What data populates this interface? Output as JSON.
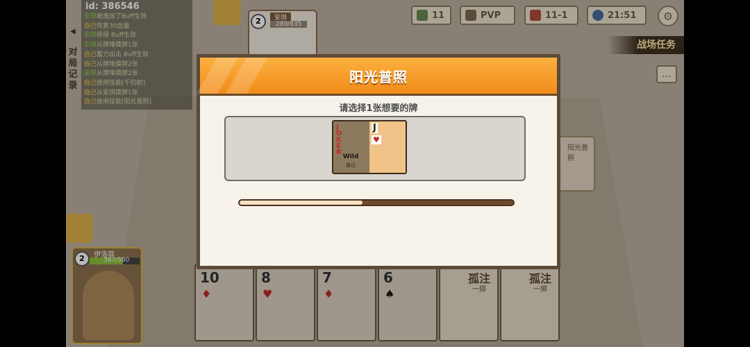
{
  "player_id": "id: 386546",
  "log_title": "对局记录",
  "log_lines": [
    {
      "who": "安琪",
      "text": "被施加了Buff生效"
    },
    {
      "who": "自己",
      "text": "恢复30血量"
    },
    {
      "who": "安琪",
      "text": "获得 Buff生效"
    },
    {
      "who": "安琪",
      "text": "从牌堆摸牌1张"
    },
    {
      "who": "自己",
      "text": "蓄力出击 Buff生效"
    },
    {
      "who": "自己",
      "text": "从牌堆摸牌2张"
    },
    {
      "who": "安琪",
      "text": "从牌堆摸牌2张"
    },
    {
      "who": "自己",
      "text": "使用技能[千钧射]"
    },
    {
      "who": "自己",
      "text": "从安琪摸牌1张"
    },
    {
      "who": "自己",
      "text": "使用技能[阳光普照]"
    }
  ],
  "topbar": {
    "cards": "11",
    "mode": "PVP",
    "round": "11-1",
    "timer": "21:51"
  },
  "task_label": "战场任务",
  "opponent": {
    "level": "2",
    "name": "安琪",
    "hp": "289/835"
  },
  "player": {
    "level": "2",
    "name": "伊洛菲",
    "hp": "387/580",
    "hp_ratio": 0.67
  },
  "hand": [
    {
      "rank": "10",
      "suit": "♦",
      "color": "#c32a2a"
    },
    {
      "rank": "8",
      "suit": "♥",
      "color": "#c32a2a"
    },
    {
      "rank": "7",
      "suit": "♦",
      "color": "#c32a2a"
    },
    {
      "rank": "6",
      "suit": "♠",
      "color": "#1a1a1a"
    },
    {
      "title": "孤注",
      "sub": "一掷"
    },
    {
      "title": "孤注",
      "sub": "一掷"
    }
  ],
  "right_card": "阳光普照",
  "modal": {
    "title": "阳光普照",
    "prompt": "请选择1张想要的牌",
    "joker_text": "JOKER",
    "joker_wild": "Wild",
    "joker_sub": "自己",
    "card_rank": "J",
    "card_suit": "♥",
    "progress": 0.45
  }
}
